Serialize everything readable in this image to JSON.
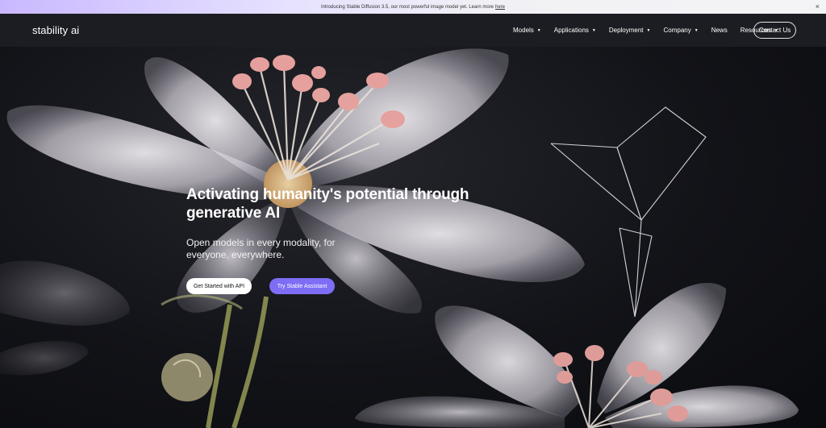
{
  "announcement": {
    "text": "Introducing Stable Diffusion 3.5, our most powerful image model yet. Learn more",
    "link_label": "here",
    "close_glyph": "×"
  },
  "nav": {
    "logo": "stability ai",
    "items": [
      {
        "label": "Models",
        "caret": "▼"
      },
      {
        "label": "Applications",
        "caret": "▼"
      },
      {
        "label": "Deployment",
        "caret": "▼"
      },
      {
        "label": "Company",
        "caret": "▼"
      },
      {
        "label": "News",
        "caret": ""
      },
      {
        "label": "Resources",
        "caret": "▼"
      }
    ],
    "contact_label": "Contact Us"
  },
  "hero": {
    "headline": "Activating humanity's potential through generative AI",
    "subhead": "Open models in every modality, for everyone, everywhere.",
    "primary_cta": "Get Started with API",
    "secondary_cta": "Try Stable Assistant"
  },
  "colors": {
    "accent": "#7d6ef5",
    "nav_bg": "#1c1d22",
    "announcement_gradient_start": "#c9b8ff"
  }
}
